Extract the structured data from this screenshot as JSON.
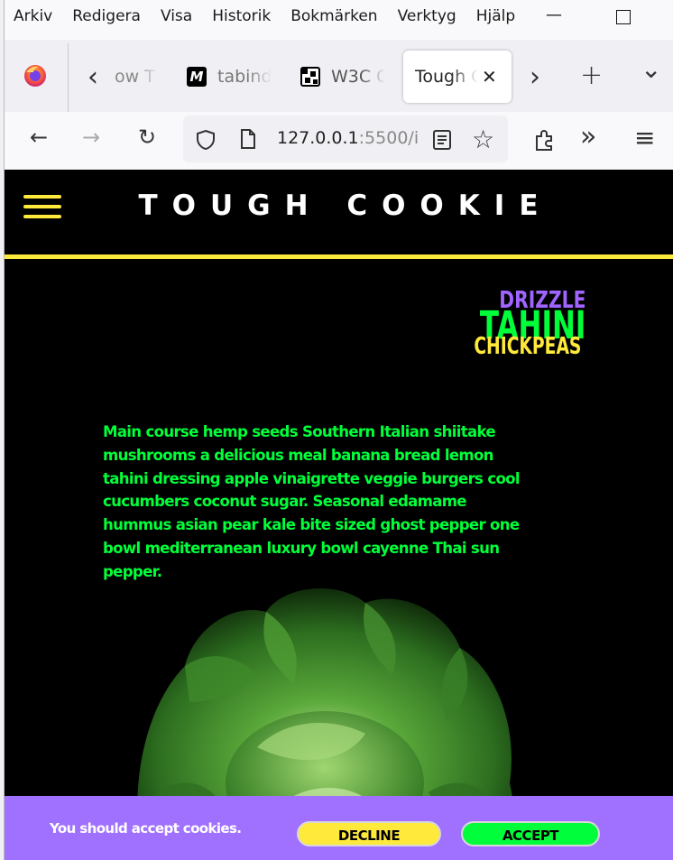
{
  "menubar": {
    "items": [
      "Arkiv",
      "Redigera",
      "Visa",
      "Historik",
      "Bokmärken",
      "Verktyg",
      "Hjälp"
    ],
    "minimize": "—",
    "maximize": "☐"
  },
  "tabs": {
    "items": [
      {
        "label": "ow T"
      },
      {
        "label": "tabind"
      },
      {
        "label": "W3C C"
      },
      {
        "label": "Tough C",
        "active": true
      }
    ],
    "tab_icon_glyph": "M",
    "close_glyph": "✕",
    "scroll_left": "‹",
    "scroll_right": "›",
    "new_tab": "+",
    "list_all": "⌄"
  },
  "navbar": {
    "url_host": "127.0.0.1",
    "url_rest": ":5500/i",
    "back": "←",
    "forward": "→",
    "reload": "↻",
    "star": "☆",
    "overflow": "»",
    "menu": "≡"
  },
  "page": {
    "brand": "TOUGH COOKIE",
    "stack": {
      "word1": "DRIZZLE",
      "word2": "TAHINI",
      "word3": "CHICKPEAS"
    },
    "blurb": "Main course hemp seeds Southern Italian shiitake mushrooms a delicious meal banana bread lemon tahini dressing apple vinaigrette veggie burgers cool cucumbers coconut sugar. Seasonal edamame hummus asian pear kale bite sized ghost pepper one bowl mediterranean luxury bowl cayenne Thai sun pepper.",
    "image_subject": "lettuce-head"
  },
  "cookie_banner": {
    "text": "You should accept cookies.",
    "decline_label": "DECLINE",
    "accept_label": "ACCEPT"
  },
  "colors": {
    "yellow": "#ffe93b",
    "green": "#00ff3a",
    "purple": "#a070ff",
    "page_bg": "#000000"
  }
}
